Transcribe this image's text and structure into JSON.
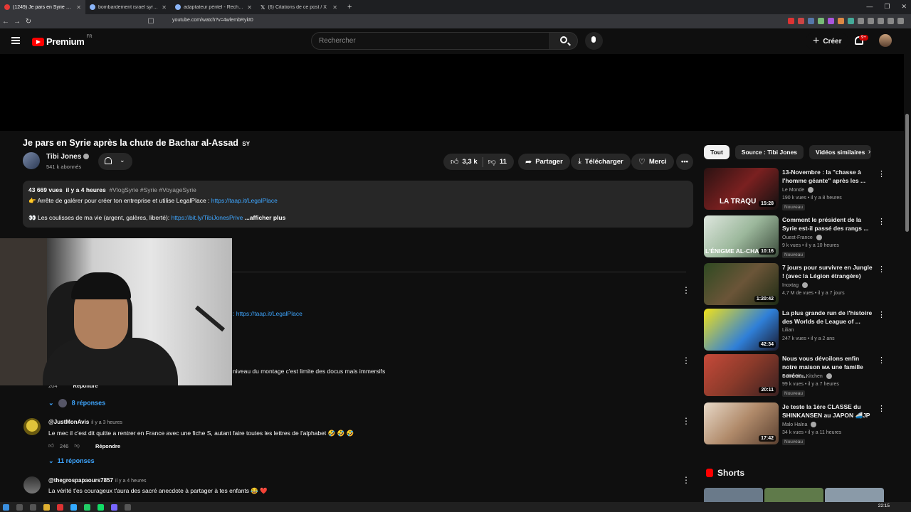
{
  "browser": {
    "tabs": [
      {
        "label": "(1249) Je pars en Syrie après la c",
        "active": true,
        "icon": "youtube-icon"
      },
      {
        "label": "bombardement israel syrie damas - R",
        "active": false,
        "icon": "google-icon"
      },
      {
        "label": "adaptateur péritel - Recherche Goog",
        "active": false,
        "icon": "google-icon"
      },
      {
        "label": "(6) Citations de ce post / X",
        "active": false,
        "icon": "x-icon"
      }
    ],
    "url": "youtube.com/watch?v=4wlembRykt0"
  },
  "header": {
    "logo_text": "Premium",
    "logo_region": "FR",
    "search_placeholder": "Rechercher",
    "create_label": "Créer",
    "notif_badge": "9+"
  },
  "video": {
    "title": "Je pars en Syrie après la chute de Bachar al-Assad",
    "title_suffix": "SY",
    "channel": "Tibi Jones",
    "subscribers": "541 k abonnés",
    "likes": "3,3 k",
    "dislikes": "11",
    "share_label": "Partager",
    "download_label": "Télécharger",
    "thanks_label": "Merci"
  },
  "description": {
    "views": "43 669 vues",
    "time": "il y a 4 heures",
    "tags": "#VlogSyrie #Syrie #VoyageSyrie",
    "line1_emoji": "👉",
    "line1_text": "Arrête de galérer pour créer ton entreprise et utilise LegalPlace :",
    "line1_link": "https://taap.it/LegalPlace",
    "line2_emoji": "👀",
    "line2_text": "Les coulisses de ma vie (argent, galères, liberté):",
    "line2_link": "https://bit.ly/TibiJonesPrive",
    "more_label": "...afficher plus"
  },
  "comments_partial": {
    "link_fragment": "https://taap.it/LegalPlace",
    "text_fragment": "niveau du montage c'est limite des docus mais immersifs",
    "likes_fragment": "204",
    "reply_fragment": "Répondre",
    "replies_label": "8 réponses"
  },
  "comments": [
    {
      "author": "@JustMonAvis",
      "time": "il y a 3 heures",
      "text": "Le mec il c'est dit quitte a rentrer en France avec une fiche S, autant faire toutes les lettres de l'alphabet 🤣 🤣 🤣",
      "likes": "246",
      "reply_label": "Répondre",
      "replies_label": "11 réponses"
    },
    {
      "author": "@thegrospapaours7857",
      "time": "il y a 4 heures",
      "text": "La vérité t'es courageux t'aura des sacré anecdote à partager à tes enfants 😂 ❤️"
    }
  ],
  "sidebar": {
    "chips": [
      "Tout",
      "Source : Tibi Jones",
      "Vidéos similaires"
    ],
    "videos": [
      {
        "title": "13-Novembre : la \"chasse à l'homme géante\" après les ...",
        "channel": "Le Monde",
        "meta": "190 k vues • il y a 8 heures",
        "badge": "Nouveau",
        "duration": "15:28",
        "thumb_text": "LA TRAQU"
      },
      {
        "title": "Comment le président de la Syrie est-il passé des rangs ...",
        "channel": "Ouest-France",
        "meta": "9 k vues • il y a 10 heures",
        "badge": "Nouveau",
        "duration": "10:16",
        "thumb_text": "L'ÉNIGME AL-CHA"
      },
      {
        "title": "7 jours pour survivre en Jungle ! (avec la Légion étrangère)",
        "channel": "Inoxtag",
        "meta": "4,7 M de vues • il y a 7 jours",
        "badge": "",
        "duration": "1:20:42",
        "thumb_text": ""
      },
      {
        "title": "La plus grande run de l'histoire des Worlds de League of ...",
        "channel": "Lilian",
        "meta": "247 k vues • il y a 2 ans",
        "badge": "",
        "duration": "42:34",
        "thumb_text": ""
      },
      {
        "title": "Nous vous dévoilons enfin notre maison ᴍᴀ une famille coréen...",
        "channel": "Bohemian Kitchen",
        "meta": "99 k vues • il y a 7 heures",
        "badge": "Nouveau",
        "duration": "20:11",
        "thumb_text": ""
      },
      {
        "title": "Je teste la 1ère CLASSE du SHINKANSEN au JAPON 🚄JP",
        "channel": "Malo Halna",
        "meta": "34 k vues • il y a 11 heures",
        "badge": "Nouveau",
        "duration": "17:42",
        "thumb_text": ""
      }
    ],
    "shorts_label": "Shorts"
  },
  "taskbar": {
    "time": "22:15"
  }
}
